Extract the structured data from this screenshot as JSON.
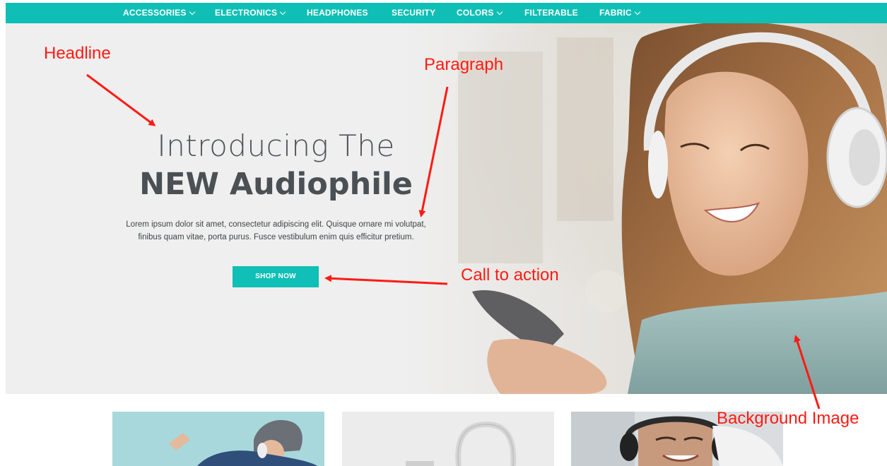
{
  "nav": {
    "items": [
      {
        "label": "ACCESSORIES",
        "dropdown": true
      },
      {
        "label": "ELECTRONICS",
        "dropdown": true
      },
      {
        "label": "HEADPHONES",
        "dropdown": false
      },
      {
        "label": "SECURITY",
        "dropdown": false
      },
      {
        "label": "COLORS",
        "dropdown": true
      },
      {
        "label": "FILTERABLE",
        "dropdown": false
      },
      {
        "label": "FABRIC",
        "dropdown": true
      }
    ],
    "background": "#0fbfb5"
  },
  "hero": {
    "headline_line1": "Introducing The",
    "headline_line2": "NEW Audiophile",
    "paragraph": "Lorem ipsum dolor sit amet, consectetur adipiscing elit. Quisque ornare mi volutpat, finibus quam vitae, porta purus. Fusce vestibulum enim quis efficitur pretium.",
    "cta_label": "SHOP NOW",
    "accent": "#10bfb5",
    "image_subject": "woman-with-headphones-photo"
  },
  "annotations": {
    "headline": "Headline",
    "paragraph": "Paragraph",
    "call_to_action": "Call to action",
    "background_image": "Background Image",
    "color": "#ff1a12"
  },
  "cards": [
    {
      "image": "person-with-headphones-photo"
    },
    {
      "image": "white-headphones-photo"
    },
    {
      "image": "man-with-headphones-photo"
    }
  ]
}
